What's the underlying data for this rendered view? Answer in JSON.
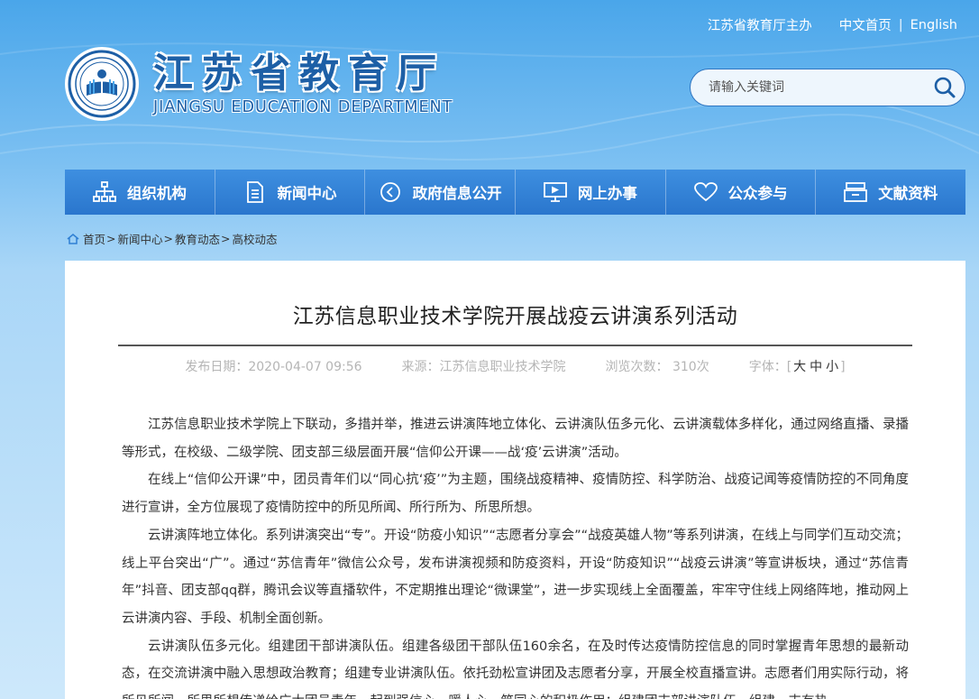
{
  "header": {
    "host_text": "江苏省教育厅主办",
    "links": {
      "home": "中文首页",
      "divider": "|",
      "english": "English"
    },
    "cn_title": "江苏省教育厅",
    "en_title": "JIANGSU EDUCATION DEPARTMENT"
  },
  "search": {
    "placeholder": "请输入关键词"
  },
  "nav": {
    "items": [
      {
        "label": "组织机构",
        "icon": "org-chart-icon"
      },
      {
        "label": "新闻中心",
        "icon": "document-icon"
      },
      {
        "label": "政府信息公开",
        "icon": "megaphone-icon"
      },
      {
        "label": "网上办事",
        "icon": "monitor-icon"
      },
      {
        "label": "公众参与",
        "icon": "heart-icon"
      },
      {
        "label": "文献资料",
        "icon": "archive-icon"
      }
    ]
  },
  "breadcrumb": {
    "home": "首页",
    "items": [
      "新闻中心",
      "教育动态",
      "高校动态"
    ],
    "separator": ">"
  },
  "article": {
    "title": "江苏信息职业技术学院开展战疫云讲演系列活动",
    "meta": {
      "date": "发布日期：2020-04-07 09:56",
      "source": "来源：江苏信息职业技术学院",
      "views": "浏览次数：  310次",
      "font_label": "字体：[",
      "font_large": "大",
      "font_medium": "中",
      "font_small": "小",
      "font_close": "]"
    },
    "paragraphs": [
      "江苏信息职业技术学院上下联动，多措并举，推进云讲演阵地立体化、云讲演队伍多元化、云讲演载体多样化，通过网络直播、录播等形式，在校级、二级学院、团支部三级层面开展“信仰公开课——战‘疫’云讲演”活动。",
      "在线上“信仰公开课”中，团员青年们以“同心抗‘疫’”为主题，围绕战疫精神、疫情防控、科学防治、战疫记闻等疫情防控的不同角度进行宣讲，全方位展现了疫情防控中的所见所闻、所行所为、所思所想。",
      "云讲演阵地立体化。系列讲演突出“专”。开设“防疫小知识”“志愿者分享会”“战疫英雄人物”等系列讲演，在线上与同学们互动交流；线上平台突出“广”。通过“苏信青年”微信公众号，发布讲演视频和防疫资料，开设“防疫知识”“战疫云讲演”等宣讲板块，通过“苏信青年”抖音、团支部qq群，腾讯会议等直播软件，不定期推出理论“微课堂”，进一步实现线上全面覆盖，牢牢守住线上网络阵地，推动网上云讲演内容、手段、机制全面创新。",
      "云讲演队伍多元化。组建团干部讲演队伍。组建各级团干部队伍160余名，在及时传达疫情防控信息的同时掌握青年思想的最新动态，在交流讲演中融入思想政治教育；组建专业讲演队伍。依托劲松宣讲团及志愿者分享，开展全校直播宣讲。志愿者们用实际行动，将所见所闻、所思所想传递给广大团员青年，起到强信心、暖人心、筑同心的积极作用；组建团支部讲演队伍，组建一支有热"
    ]
  },
  "colors": {
    "nav_bg": "#2f7fd3",
    "title_blue": "#1d5fa6",
    "page_bg": "#7cc0f2"
  }
}
